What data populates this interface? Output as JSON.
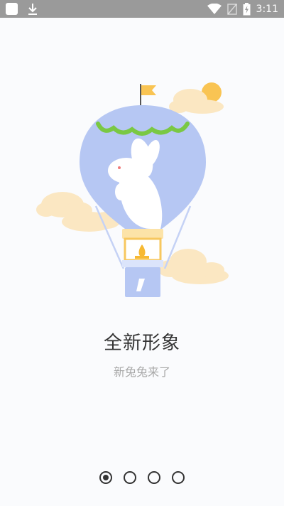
{
  "status_bar": {
    "time": "3:11",
    "icons": [
      "notification-square-icon",
      "download-icon",
      "wifi-icon",
      "no-sim-icon",
      "battery-charging-icon"
    ]
  },
  "onboarding": {
    "title": "全新形象",
    "subtitle": "新兔兔来了",
    "illustration": "hot-air-balloon-rabbit",
    "page_count": 4,
    "active_page": 1
  },
  "colors": {
    "balloon": "#b6c7f3",
    "balloon_trim": "#7ac843",
    "basket": "#fce3a8",
    "flame": "#f7b933",
    "cloud": "#fbe7c2",
    "sun": "#f9c453",
    "status_bar": "#9a9a9a"
  }
}
